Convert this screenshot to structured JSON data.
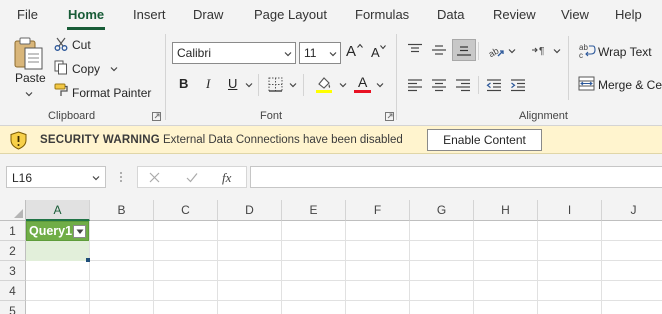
{
  "menu": {
    "tabs": [
      "File",
      "Home",
      "Insert",
      "Draw",
      "Page Layout",
      "Formulas",
      "Data",
      "Review",
      "View",
      "Help"
    ],
    "active": "Home"
  },
  "clipboard": {
    "paste_label": "Paste",
    "cut_label": "Cut",
    "copy_label": "Copy",
    "format_painter_label": "Format Painter",
    "group_label": "Clipboard"
  },
  "font": {
    "font_name": "Calibri",
    "font_size": "11",
    "group_label": "Font",
    "bold_label": "B",
    "italic_label": "I",
    "underline_label": "U",
    "grow_label": "A",
    "shrink_label": "A",
    "font_color_label": "A",
    "highlight_color": "#ffff00",
    "font_color": "#e81123"
  },
  "alignment": {
    "wrap_text_label": "Wrap Text",
    "merge_label": "Merge & Ce",
    "group_label": "Alignment"
  },
  "security_bar": {
    "title": "SECURITY WARNING",
    "message": "External Data Connections have been disabled",
    "button_label": "Enable Content"
  },
  "formula_bar": {
    "name_box": "L16",
    "fx_label": "fx",
    "formula": ""
  },
  "grid": {
    "columns": [
      "A",
      "B",
      "C",
      "D",
      "E",
      "F",
      "G",
      "H",
      "I",
      "J"
    ],
    "rows": [
      "1",
      "2",
      "3",
      "4",
      "5"
    ],
    "selected_column": "A",
    "cells": {
      "A1": "Query1"
    }
  },
  "colors": {
    "accent": "#217346",
    "table_header": "#70ad47",
    "table_row": "#e2efda",
    "warning_bg": "#fff4ce"
  }
}
